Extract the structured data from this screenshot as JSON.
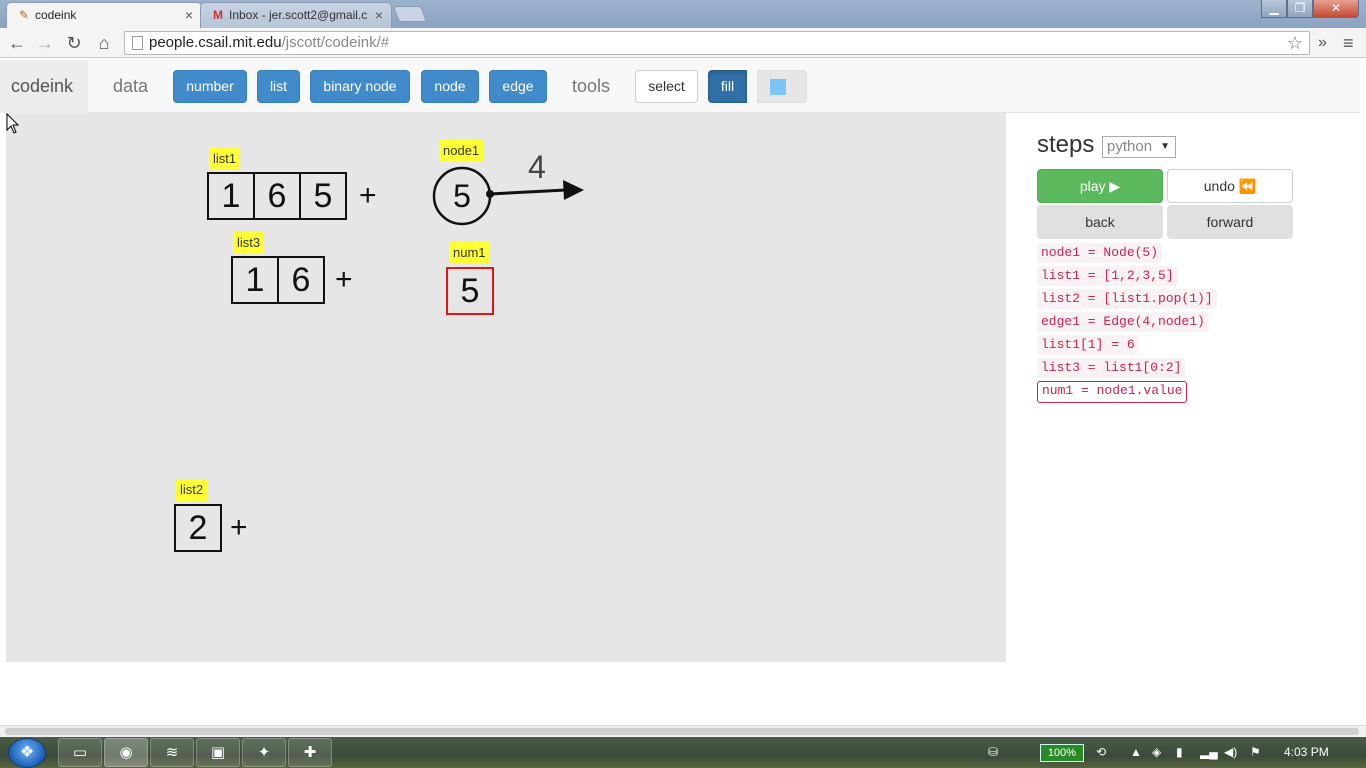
{
  "browser": {
    "tabs": [
      {
        "title": "codeink",
        "icon": "codeink-favicon",
        "close": "×"
      },
      {
        "title": "Inbox - jer.scott2@gmail.c",
        "icon": "gmail-icon",
        "close": "×"
      }
    ],
    "url_host": "people.csail.mit.edu",
    "url_path": "/jscott/codeink/#",
    "window_controls": {
      "minimize": "▁",
      "maximize": "❐",
      "close": "✕"
    }
  },
  "navbar": {
    "brand": "codeink",
    "data_label": "data",
    "data_buttons": [
      "number",
      "list",
      "binary node",
      "node",
      "edge"
    ],
    "tools_label": "tools",
    "select_label": "select",
    "fill_label": "fill",
    "fill_color": "#7ec3f5"
  },
  "canvas": {
    "list1": {
      "label": "list1",
      "cells": [
        "1",
        "6",
        "5"
      ],
      "plus": "+"
    },
    "list3": {
      "label": "list3",
      "cells": [
        "1",
        "6"
      ],
      "plus": "+"
    },
    "list2": {
      "label": "list2",
      "cells": [
        "2"
      ],
      "plus": "+"
    },
    "node1": {
      "label": "node1",
      "value": "5"
    },
    "edge1": {
      "label": "4"
    },
    "num1": {
      "label": "num1",
      "value": "5"
    }
  },
  "steps": {
    "title": "steps",
    "language": "python",
    "play": "play ▶",
    "undo": "undo ⏪",
    "back": "back",
    "forward": "forward",
    "lines": [
      "node1 = Node(5)",
      "list1 = [1,2,3,5]",
      "list2 = [list1.pop(1)]",
      "edge1 = Edge(4,node1)",
      "list1[1] = 6",
      "list3 = list1[0:2]",
      "num1 = node1.value"
    ],
    "current_index": 6
  },
  "taskbar": {
    "battery": "100%",
    "time": "4:03 PM"
  }
}
